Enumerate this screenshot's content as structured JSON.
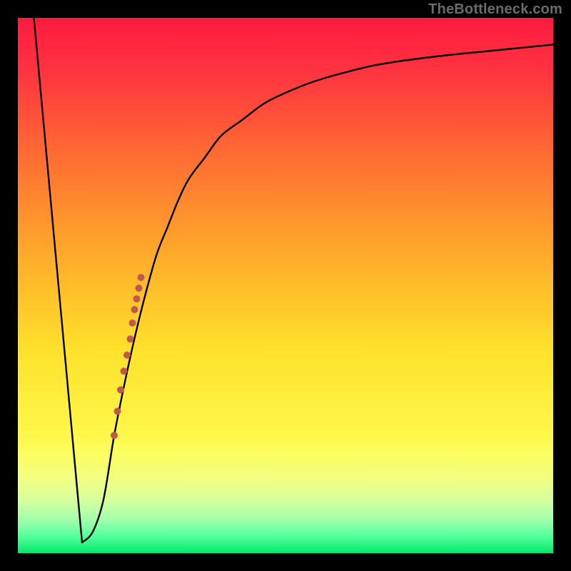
{
  "attribution": "TheBottleneck.com",
  "gradient_stops": [
    {
      "offset": 0,
      "color": "#ff1a3f"
    },
    {
      "offset": 0.1,
      "color": "#ff3340"
    },
    {
      "offset": 0.25,
      "color": "#ff6a33"
    },
    {
      "offset": 0.45,
      "color": "#ffad2a"
    },
    {
      "offset": 0.62,
      "color": "#ffe12c"
    },
    {
      "offset": 0.78,
      "color": "#fff84a"
    },
    {
      "offset": 0.82,
      "color": "#fbff66"
    },
    {
      "offset": 0.86,
      "color": "#f1ff82"
    },
    {
      "offset": 0.9,
      "color": "#d8ff9e"
    },
    {
      "offset": 0.94,
      "color": "#9effad"
    },
    {
      "offset": 0.97,
      "color": "#4dff9a"
    },
    {
      "offset": 1.0,
      "color": "#05e76a"
    }
  ],
  "chart_data": {
    "type": "line",
    "title": "",
    "xlabel": "",
    "ylabel": "",
    "xlim": [
      0,
      100
    ],
    "ylim": [
      0,
      100
    ],
    "series": [
      {
        "name": "bottleneck-curve",
        "x": [
          3,
          12,
          14,
          16,
          18,
          20,
          22,
          24,
          26,
          28,
          30,
          32,
          35,
          38,
          42,
          46,
          50,
          55,
          60,
          66,
          72,
          80,
          90,
          100
        ],
        "y": [
          100,
          2,
          4,
          10,
          22,
          32,
          41,
          49,
          56,
          61,
          66,
          70,
          74,
          78,
          81,
          84,
          86,
          88,
          89.5,
          91,
          92,
          93,
          94,
          95
        ]
      }
    ],
    "markers": {
      "name": "highlight-segment",
      "x": [
        18.0,
        18.6,
        19.2,
        19.8,
        20.4,
        21.0,
        21.4,
        21.8,
        22.2,
        22.6,
        23.0
      ],
      "y": [
        22,
        26.5,
        30.5,
        34,
        37,
        40,
        43,
        45.5,
        47.5,
        49.5,
        51.5
      ],
      "color": "#c1584f",
      "size": 10
    }
  }
}
